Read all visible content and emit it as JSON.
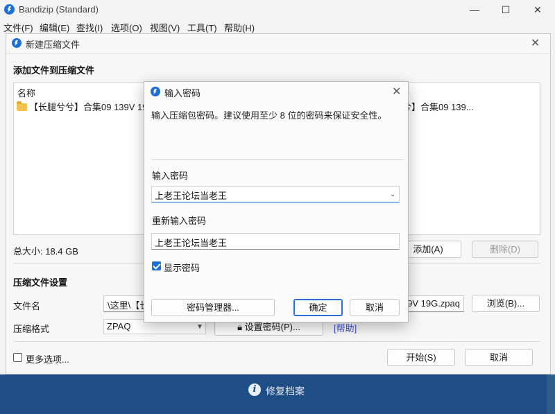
{
  "window": {
    "title": "Bandizip (Standard)",
    "minimize": "—",
    "maximize": "☐",
    "close": "✕"
  },
  "menu": [
    "文件(F)",
    "编辑(E)",
    "查找(I)",
    "选项(O)",
    "视图(V)",
    "工具(T)",
    "帮助(H)"
  ],
  "new_archive": {
    "title": "新建压缩文件",
    "close": "✕",
    "add_files_heading": "添加文件到压缩文件",
    "list_header": "名称",
    "file_name_left": "【长腿兮兮】合集09 139V 19",
    "file_name_right": "兮】合集09 139...",
    "total_size": "总大小: 18.4 GB",
    "add_button": "添加(A)",
    "delete_button": "删除(D)",
    "settings_heading": "压缩文件设置",
    "filename_label": "文件名",
    "filename_value_left": "\\这里\\【长",
    "filename_value_right": "9V 19G.zpaq",
    "browse_button": "浏览(B)...",
    "format_label": "压缩格式",
    "format_value": "ZPAQ",
    "set_password_button": "设置密码(P)...",
    "help_link": "[帮助]",
    "more_options": "更多选项...",
    "start_button": "开始(S)",
    "cancel_button": "取消"
  },
  "bottom_bar": {
    "info_glyph": "i",
    "label": "修复档案"
  },
  "password_dialog": {
    "title": "输入密码",
    "close": "✕",
    "description": "输入压缩包密码。建议使用至少 8 位的密码来保证安全性。",
    "enter_label": "输入密码",
    "enter_value": "上老王论坛当老王",
    "reenter_label": "重新输入密码",
    "reenter_value": "上老王论坛当老王",
    "show_password_label": "显示密码",
    "show_password_checked": true,
    "manager_button": "密码管理器...",
    "ok_button": "确定",
    "cancel_button": "取消"
  },
  "colors": {
    "accent": "#1d6fd6",
    "bottom_bar": "#1f4e86",
    "link": "#3a4fd0",
    "folder": "#f2c14e"
  },
  "icons": {
    "app": "bandizip-icon",
    "folder": "folder-icon",
    "info": "info-icon",
    "lock": "lock-icon",
    "dropdown": "chevron-down-icon"
  }
}
